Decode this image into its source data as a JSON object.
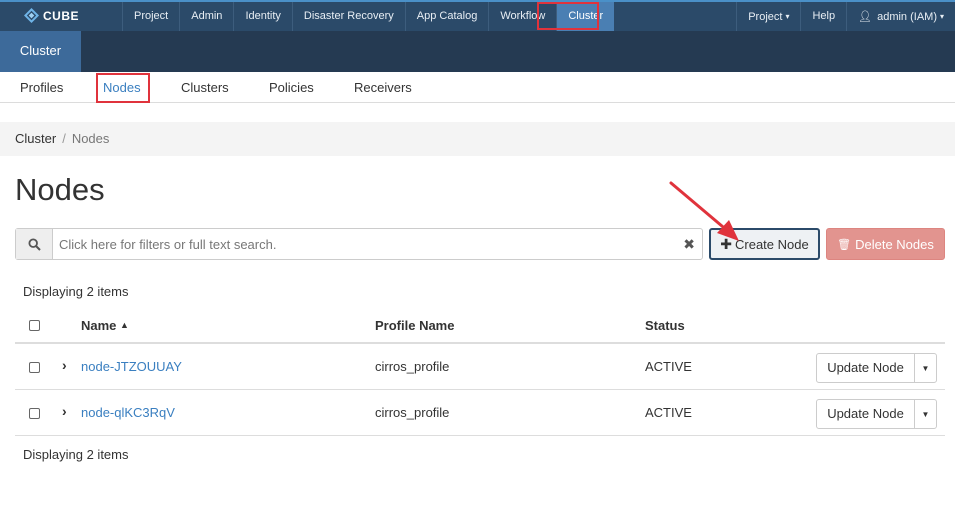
{
  "topbar": {
    "brand": "CUBE",
    "left_items": [
      "Project",
      "Admin",
      "Identity",
      "Disaster Recovery",
      "App Catalog",
      "Workflow",
      "Cluster"
    ],
    "active_item": "Cluster",
    "right_items": {
      "project": "Project",
      "help": "Help",
      "user": "admin (IAM)"
    }
  },
  "subheader": {
    "tab": "Cluster"
  },
  "subnav": {
    "items": [
      "Profiles",
      "Nodes",
      "Clusters",
      "Policies",
      "Receivers"
    ],
    "active": "Nodes"
  },
  "breadcrumb": {
    "root": "Cluster",
    "separator": "/",
    "current": "Nodes"
  },
  "page_title": "Nodes",
  "search": {
    "placeholder": "Click here for filters or full text search.",
    "value": ""
  },
  "actions": {
    "create": "Create Node",
    "delete": "Delete Nodes"
  },
  "table": {
    "count_top": "Displaying 2 items",
    "count_bottom": "Displaying 2 items",
    "headers": {
      "name": "Name",
      "profile": "Profile Name",
      "status": "Status"
    },
    "rows": [
      {
        "name": "node-JTZOUUAY",
        "profile": "cirros_profile",
        "status": "ACTIVE",
        "action": "Update Node"
      },
      {
        "name": "node-qlKC3RqV",
        "profile": "cirros_profile",
        "status": "ACTIVE",
        "action": "Update Node"
      }
    ]
  },
  "colors": {
    "navbar": "#2b4a69",
    "subheader": "#253a52",
    "active_tab": "#3d6a9a",
    "link": "#3a7fc0",
    "danger_button": "#e2948f",
    "annotation": "#e0333c"
  }
}
